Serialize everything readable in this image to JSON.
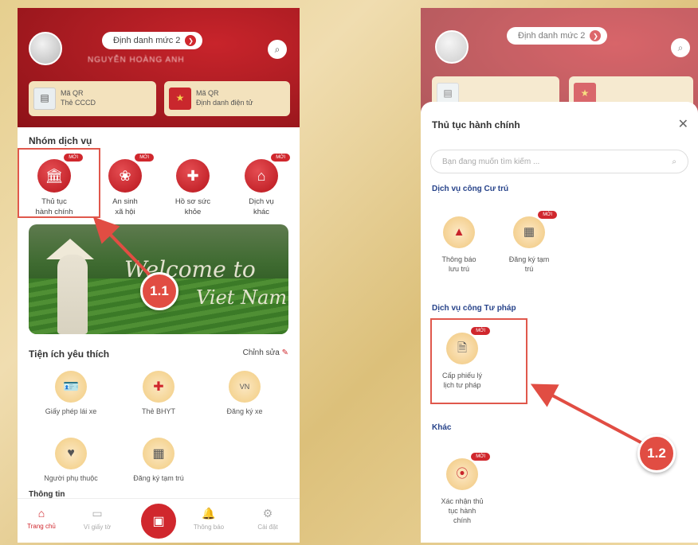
{
  "left": {
    "id_level": "Định danh mức 2",
    "user_name": "NGUYỄN HOÀNG ANH",
    "qr_cards": [
      {
        "line1": "Mã QR",
        "line2": "Thẻ CCCD"
      },
      {
        "line1": "Mã QR",
        "line2": "Định danh điện tử"
      }
    ],
    "service_group_title": "Nhóm dịch vụ",
    "services": [
      {
        "label1": "Thủ tục",
        "label2": "hành chính",
        "badge": "MỚI"
      },
      {
        "label1": "An sinh",
        "label2": "xã hội",
        "badge": "MỚI"
      },
      {
        "label1": "Hồ sơ sức",
        "label2": "khỏe",
        "badge": ""
      },
      {
        "label1": "Dịch vụ",
        "label2": "khác",
        "badge": "MỚI"
      }
    ],
    "banner_line1": "Welcome to",
    "banner_line2": "Viet Nam",
    "step1": "1.1",
    "favorites_title": "Tiện ích yêu thích",
    "edit_label": "Chỉnh sửa",
    "favorites": [
      {
        "label": "Giấy phép lái xe",
        "icon": "license-icon"
      },
      {
        "label": "Thẻ BHYT",
        "icon": "health-insurance-icon"
      },
      {
        "label": "Đăng ký xe",
        "icon": "vehicle-registration-icon"
      },
      {
        "label": "Người phụ thuộc",
        "icon": "dependents-icon"
      },
      {
        "label": "Đăng ký tạm trú",
        "icon": "temporary-residence-icon"
      }
    ],
    "next_section": "Thông tin",
    "nav": [
      {
        "label": "Trang chủ"
      },
      {
        "label": "Ví giấy tờ"
      },
      {
        "label": "Thông báo"
      },
      {
        "label": "Cài đặt"
      }
    ]
  },
  "right": {
    "id_level": "Định danh mức 2",
    "sheet_title": "Thủ tục hành chính",
    "search_placeholder": "Bạn đang muốn tìm kiếm ...",
    "sections": [
      {
        "title": "Dịch vụ công Cư trú",
        "items": [
          {
            "label1": "Thông báo",
            "label2": "lưu trú",
            "badge": ""
          },
          {
            "label1": "Đăng ký tạm",
            "label2": "trú",
            "badge": "MỚI"
          }
        ]
      },
      {
        "title": "Dịch vụ công Tư pháp",
        "items": [
          {
            "label1": "Cấp phiếu lý",
            "label2": "lịch tư pháp",
            "badge": "MỚI"
          }
        ]
      },
      {
        "title": "Khác",
        "items": [
          {
            "label1": "Xác nhận thủ",
            "label2": "tục hành",
            "label3": "chính",
            "badge": "MỚI"
          }
        ]
      }
    ],
    "step2": "1.2"
  },
  "colors": {
    "brand_red": "#c8242b",
    "annotation_red": "#e14d43",
    "section_blue": "#27438a"
  }
}
